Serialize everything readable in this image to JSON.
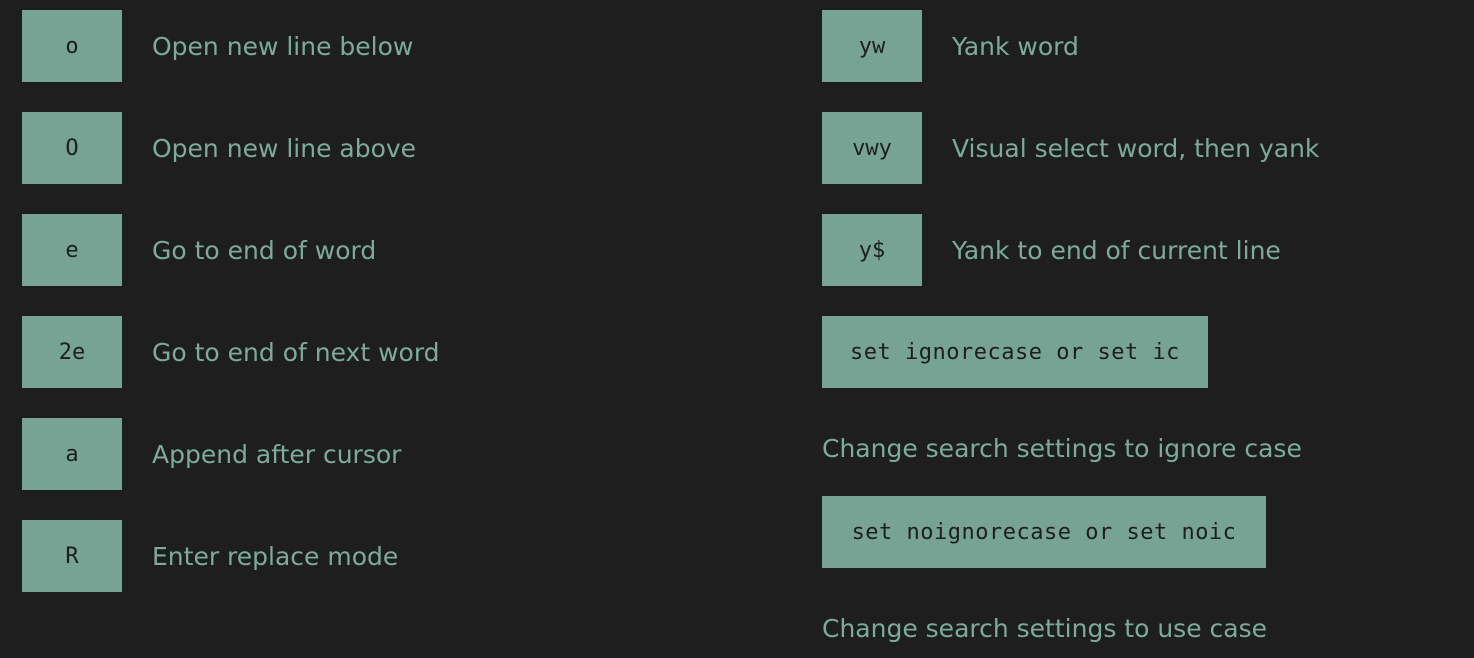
{
  "left": [
    {
      "key": "o",
      "desc": "Open new line below"
    },
    {
      "key": "O",
      "desc": "Open new line above"
    },
    {
      "key": "e",
      "desc": "Go to end of word"
    },
    {
      "key": "2e",
      "desc": "Go to end of next word"
    },
    {
      "key": "a",
      "desc": "Append after cursor"
    },
    {
      "key": "R",
      "desc": "Enter replace mode"
    }
  ],
  "right": [
    {
      "key": "yw",
      "desc": "Yank word"
    },
    {
      "key": "vwy",
      "desc": "Visual select word, then yank"
    },
    {
      "key": "y$",
      "desc": "Yank to end of current line"
    }
  ],
  "commands": [
    {
      "key": "set ignorecase or set ic",
      "desc": "Change search settings to ignore case"
    },
    {
      "key": "set noignorecase or set noic",
      "desc": "Change search settings to use case"
    }
  ],
  "colors": {
    "background": "#1e1e1e",
    "key_fill": "#77a394",
    "text": "#7dab9a"
  }
}
